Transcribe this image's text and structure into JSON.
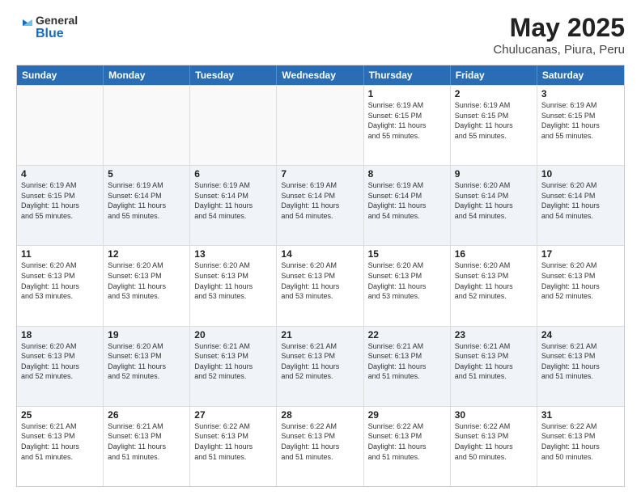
{
  "logo": {
    "line1": "General",
    "line2": "Blue"
  },
  "title": "May 2025",
  "subtitle": "Chulucanas, Piura, Peru",
  "days": [
    "Sunday",
    "Monday",
    "Tuesday",
    "Wednesday",
    "Thursday",
    "Friday",
    "Saturday"
  ],
  "weeks": [
    [
      {
        "day": "",
        "text": "",
        "empty": true
      },
      {
        "day": "",
        "text": "",
        "empty": true
      },
      {
        "day": "",
        "text": "",
        "empty": true
      },
      {
        "day": "",
        "text": "",
        "empty": true
      },
      {
        "day": "1",
        "text": "Sunrise: 6:19 AM\nSunset: 6:15 PM\nDaylight: 11 hours\nand 55 minutes."
      },
      {
        "day": "2",
        "text": "Sunrise: 6:19 AM\nSunset: 6:15 PM\nDaylight: 11 hours\nand 55 minutes."
      },
      {
        "day": "3",
        "text": "Sunrise: 6:19 AM\nSunset: 6:15 PM\nDaylight: 11 hours\nand 55 minutes."
      }
    ],
    [
      {
        "day": "4",
        "text": "Sunrise: 6:19 AM\nSunset: 6:15 PM\nDaylight: 11 hours\nand 55 minutes."
      },
      {
        "day": "5",
        "text": "Sunrise: 6:19 AM\nSunset: 6:14 PM\nDaylight: 11 hours\nand 55 minutes."
      },
      {
        "day": "6",
        "text": "Sunrise: 6:19 AM\nSunset: 6:14 PM\nDaylight: 11 hours\nand 54 minutes."
      },
      {
        "day": "7",
        "text": "Sunrise: 6:19 AM\nSunset: 6:14 PM\nDaylight: 11 hours\nand 54 minutes."
      },
      {
        "day": "8",
        "text": "Sunrise: 6:19 AM\nSunset: 6:14 PM\nDaylight: 11 hours\nand 54 minutes."
      },
      {
        "day": "9",
        "text": "Sunrise: 6:20 AM\nSunset: 6:14 PM\nDaylight: 11 hours\nand 54 minutes."
      },
      {
        "day": "10",
        "text": "Sunrise: 6:20 AM\nSunset: 6:14 PM\nDaylight: 11 hours\nand 54 minutes."
      }
    ],
    [
      {
        "day": "11",
        "text": "Sunrise: 6:20 AM\nSunset: 6:13 PM\nDaylight: 11 hours\nand 53 minutes."
      },
      {
        "day": "12",
        "text": "Sunrise: 6:20 AM\nSunset: 6:13 PM\nDaylight: 11 hours\nand 53 minutes."
      },
      {
        "day": "13",
        "text": "Sunrise: 6:20 AM\nSunset: 6:13 PM\nDaylight: 11 hours\nand 53 minutes."
      },
      {
        "day": "14",
        "text": "Sunrise: 6:20 AM\nSunset: 6:13 PM\nDaylight: 11 hours\nand 53 minutes."
      },
      {
        "day": "15",
        "text": "Sunrise: 6:20 AM\nSunset: 6:13 PM\nDaylight: 11 hours\nand 53 minutes."
      },
      {
        "day": "16",
        "text": "Sunrise: 6:20 AM\nSunset: 6:13 PM\nDaylight: 11 hours\nand 52 minutes."
      },
      {
        "day": "17",
        "text": "Sunrise: 6:20 AM\nSunset: 6:13 PM\nDaylight: 11 hours\nand 52 minutes."
      }
    ],
    [
      {
        "day": "18",
        "text": "Sunrise: 6:20 AM\nSunset: 6:13 PM\nDaylight: 11 hours\nand 52 minutes."
      },
      {
        "day": "19",
        "text": "Sunrise: 6:20 AM\nSunset: 6:13 PM\nDaylight: 11 hours\nand 52 minutes."
      },
      {
        "day": "20",
        "text": "Sunrise: 6:21 AM\nSunset: 6:13 PM\nDaylight: 11 hours\nand 52 minutes."
      },
      {
        "day": "21",
        "text": "Sunrise: 6:21 AM\nSunset: 6:13 PM\nDaylight: 11 hours\nand 52 minutes."
      },
      {
        "day": "22",
        "text": "Sunrise: 6:21 AM\nSunset: 6:13 PM\nDaylight: 11 hours\nand 51 minutes."
      },
      {
        "day": "23",
        "text": "Sunrise: 6:21 AM\nSunset: 6:13 PM\nDaylight: 11 hours\nand 51 minutes."
      },
      {
        "day": "24",
        "text": "Sunrise: 6:21 AM\nSunset: 6:13 PM\nDaylight: 11 hours\nand 51 minutes."
      }
    ],
    [
      {
        "day": "25",
        "text": "Sunrise: 6:21 AM\nSunset: 6:13 PM\nDaylight: 11 hours\nand 51 minutes."
      },
      {
        "day": "26",
        "text": "Sunrise: 6:21 AM\nSunset: 6:13 PM\nDaylight: 11 hours\nand 51 minutes."
      },
      {
        "day": "27",
        "text": "Sunrise: 6:22 AM\nSunset: 6:13 PM\nDaylight: 11 hours\nand 51 minutes."
      },
      {
        "day": "28",
        "text": "Sunrise: 6:22 AM\nSunset: 6:13 PM\nDaylight: 11 hours\nand 51 minutes."
      },
      {
        "day": "29",
        "text": "Sunrise: 6:22 AM\nSunset: 6:13 PM\nDaylight: 11 hours\nand 51 minutes."
      },
      {
        "day": "30",
        "text": "Sunrise: 6:22 AM\nSunset: 6:13 PM\nDaylight: 11 hours\nand 50 minutes."
      },
      {
        "day": "31",
        "text": "Sunrise: 6:22 AM\nSunset: 6:13 PM\nDaylight: 11 hours\nand 50 minutes."
      }
    ]
  ]
}
